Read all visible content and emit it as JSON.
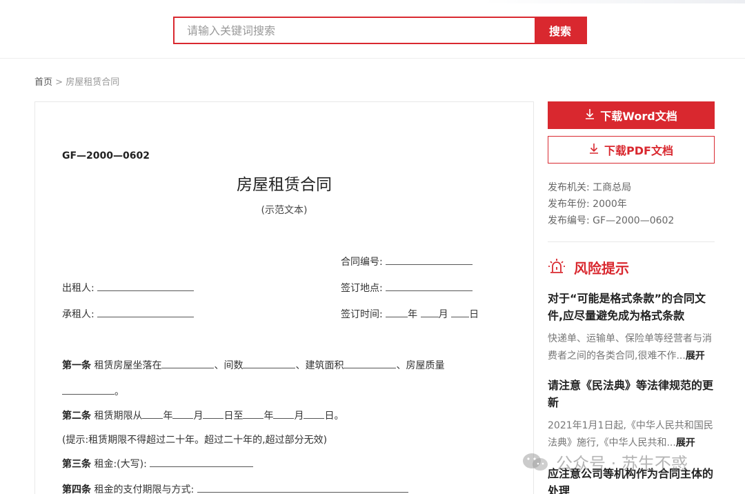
{
  "search": {
    "placeholder": "请输入关键词搜索",
    "button_label": "搜索"
  },
  "breadcrumb": {
    "home": "首页",
    "separator": ">",
    "current": "房屋租赁合同"
  },
  "document": {
    "code": "GF—2000—0602",
    "title": "房屋租赁合同",
    "subtitle": "(示范文本)",
    "fields": {
      "contract_no": "合同编号:",
      "lessor": "出租人:",
      "sign_place": "签订地点:",
      "lessee": "承租人:",
      "sign_time": "签订时间:",
      "year": "年",
      "month": "月",
      "day": "日"
    },
    "clauses": [
      {
        "label": "第一条",
        "text": "租赁房屋坐落在",
        "t2": "、间数",
        "t3": "、建筑面积",
        "t4": "、房屋质量"
      },
      {
        "tail": "。"
      },
      {
        "label": "第二条",
        "text": "租赁期限从",
        "y1": "年",
        "m1": "月",
        "d1": "日至",
        "y2": "年",
        "m2": "月",
        "d2": "日。"
      },
      {
        "text": "(提示:租赁期限不得超过二十年。超过二十年的,超过部分无效)"
      },
      {
        "label": "第三条",
        "text": "租金:(大写):"
      },
      {
        "label": "第四条",
        "text": "租金的支付期限与方式:"
      }
    ]
  },
  "sidebar": {
    "download_word": "下载Word文档",
    "download_pdf": "下载PDF文档",
    "meta": [
      "发布机关: 工商总局",
      "发布年份: 2000年",
      "发布编号: GF—2000—0602"
    ],
    "risk_title": "风险提示",
    "tips": [
      {
        "title": "对于“可能是格式条款”的合同文件,应尽量避免成为格式条款",
        "text": "快递单、运输单、保险单等经营者与消费者之间的各类合同,很难不作...",
        "expand": "展开"
      },
      {
        "title": "请注意《民法典》等法律规范的更新",
        "text": "2021年1月1日起,《中华人民共和国民法典》施行,《中华人民共和...",
        "expand": "展开"
      },
      {
        "title": "应注意公司等机构作为合同主体的处理"
      }
    ]
  },
  "watermark": {
    "text": "公众号 · 苏生不惑"
  },
  "colors": {
    "accent": "#d9282f"
  },
  "icons": {
    "download": "download-icon",
    "risk": "alarm-light-icon",
    "watermark": "wechat-icon"
  }
}
